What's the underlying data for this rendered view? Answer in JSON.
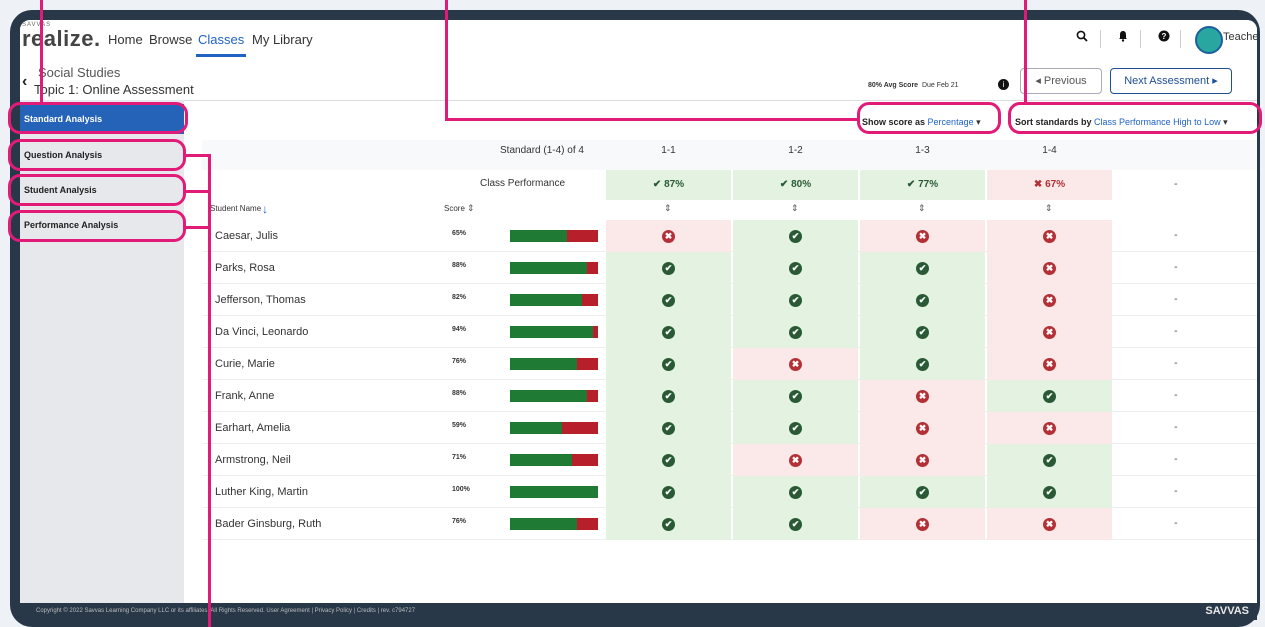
{
  "nav": {
    "logo_small": "SAVVAS",
    "logo": "realize.",
    "links": [
      "Home",
      "Browse",
      "Classes",
      "My Library"
    ],
    "user": "Teacher"
  },
  "header": {
    "subject": "Social Studies",
    "topic": "Topic 1: Online Assessment",
    "avg_score": "80% Avg Score",
    "due": "Due Feb 21",
    "previous": "◂ Previous",
    "next": "Next Assessment ▸"
  },
  "sidebar": {
    "items": [
      "Standard Analysis",
      "Question Analysis",
      "Student Analysis",
      "Performance Analysis"
    ]
  },
  "controls": {
    "show_label": "Show score as",
    "show_value": "Percentage",
    "sort_label": "Sort standards by",
    "sort_value": "Class Performance High to Low"
  },
  "table": {
    "standard_header": "Standard (1-4) of 4",
    "standards": [
      "1-1",
      "1-2",
      "1-3",
      "1-4"
    ],
    "class_perf_label": "Class Performance",
    "class_perf": [
      "87%",
      "80%",
      "77%",
      "67%"
    ],
    "class_perf_status": [
      "ok",
      "ok",
      "ok",
      "bad"
    ],
    "col_student": "Student Name",
    "col_score": "Score",
    "dash": "-",
    "students": [
      {
        "name": "Caesar, Julis",
        "score": "65%",
        "pct": 65,
        "marks": [
          "bad",
          "ok",
          "bad",
          "bad"
        ]
      },
      {
        "name": "Parks, Rosa",
        "score": "88%",
        "pct": 88,
        "marks": [
          "ok",
          "ok",
          "ok",
          "bad"
        ]
      },
      {
        "name": "Jefferson, Thomas",
        "score": "82%",
        "pct": 82,
        "marks": [
          "ok",
          "ok",
          "ok",
          "bad"
        ]
      },
      {
        "name": "Da Vinci, Leonardo",
        "score": "94%",
        "pct": 94,
        "marks": [
          "ok",
          "ok",
          "ok",
          "bad"
        ]
      },
      {
        "name": "Curie, Marie",
        "score": "76%",
        "pct": 76,
        "marks": [
          "ok",
          "bad",
          "ok",
          "bad"
        ]
      },
      {
        "name": "Frank, Anne",
        "score": "88%",
        "pct": 88,
        "marks": [
          "ok",
          "ok",
          "bad",
          "ok"
        ]
      },
      {
        "name": "Earhart, Amelia",
        "score": "59%",
        "pct": 59,
        "marks": [
          "ok",
          "ok",
          "bad",
          "bad"
        ]
      },
      {
        "name": "Armstrong, Neil",
        "score": "71%",
        "pct": 71,
        "marks": [
          "ok",
          "bad",
          "bad",
          "ok"
        ]
      },
      {
        "name": "Luther King, Martin",
        "score": "100%",
        "pct": 100,
        "marks": [
          "ok",
          "ok",
          "ok",
          "ok"
        ]
      },
      {
        "name": "Bader Ginsburg, Ruth",
        "score": "76%",
        "pct": 76,
        "marks": [
          "ok",
          "ok",
          "bad",
          "bad"
        ]
      }
    ]
  },
  "footer": {
    "text": "Copyright © 2022 Savvas Learning Company LLC or its affiliates. All Rights Reserved. User Agreement | Privacy Policy | Credits | rev. c794727",
    "brand": "SAVVAS"
  },
  "colors": {
    "accent": "#1f62c4",
    "callout": "#e31b78",
    "ok_bg": "#e3f2e1",
    "bad_bg": "#fbe9ea"
  }
}
